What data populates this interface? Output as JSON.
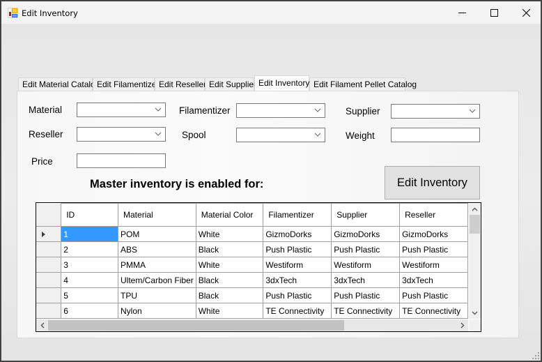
{
  "window": {
    "title": "Edit Inventory",
    "icon": "form-app-icon",
    "controls": [
      "minimize",
      "maximize",
      "close"
    ]
  },
  "tabs": [
    {
      "label": "Edit Material Catalog",
      "active": false
    },
    {
      "label": "Edit Filamentizer",
      "active": false
    },
    {
      "label": "Edit Reseller",
      "active": false
    },
    {
      "label": "Edit Supplier",
      "active": false
    },
    {
      "label": "Edit Inventory",
      "active": true
    },
    {
      "label": "Edit Filament Pellet Catalog",
      "active": false
    }
  ],
  "form": {
    "material_label": "Material",
    "material_value": "",
    "filamentizer_label": "Filamentizer",
    "filamentizer_value": "",
    "supplier_label": "Supplier",
    "supplier_value": "",
    "reseller_label": "Reseller",
    "reseller_value": "",
    "spool_label": "Spool",
    "spool_value": "",
    "weight_label": "Weight",
    "weight_value": "",
    "price_label": "Price",
    "price_value": ""
  },
  "heading": "Master inventory is enabled for:",
  "edit_button_label": "Edit Inventory",
  "grid": {
    "columns": [
      "ID",
      "Material",
      "Material Color",
      "Filamentizer",
      "Supplier",
      "Reseller"
    ],
    "rows": [
      [
        "1",
        "POM",
        "White",
        "GizmoDorks",
        "GizmoDorks",
        "GizmoDorks"
      ],
      [
        "2",
        "ABS",
        "Black",
        "Push Plastic",
        "Push Plastic",
        "Push Plastic"
      ],
      [
        "3",
        "PMMA",
        "White",
        "Westiform",
        "Westiform",
        "Westiform"
      ],
      [
        "4",
        "Ultem/Carbon Fiber",
        "Black",
        "3dxTech",
        "3dxTech",
        "3dxTech"
      ],
      [
        "5",
        "TPU",
        "Black",
        "Push Plastic",
        "Push Plastic",
        "Push Plastic"
      ],
      [
        "6",
        "Nylon",
        "White",
        "TE Connectivity",
        "TE Connectivity",
        "TE Connectivity"
      ]
    ],
    "current_row": 0,
    "selected_cell": {
      "row": 0,
      "col": 0
    },
    "selection_color": "#3399ff"
  }
}
